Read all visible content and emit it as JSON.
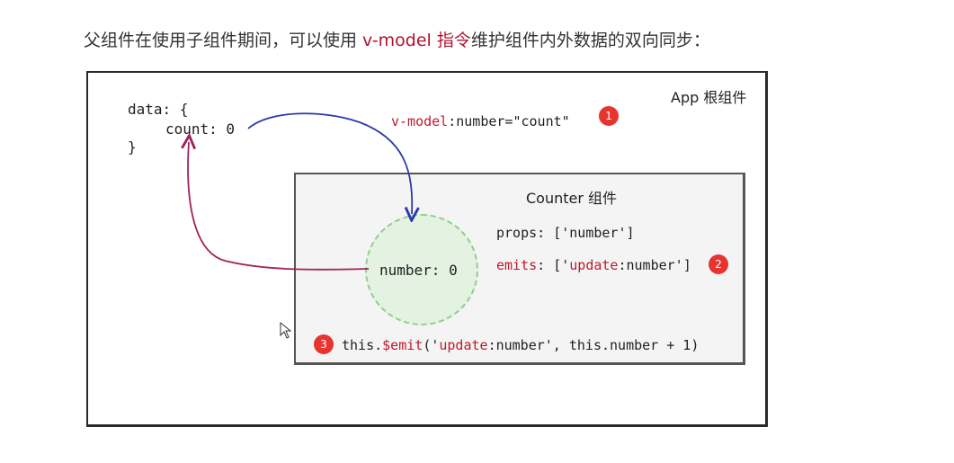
{
  "heading": {
    "prefix": "父组件在使用子组件期间，可以使用 ",
    "highlight": "v-model 指令",
    "suffix": "维护组件内外数据的双向同步："
  },
  "app": {
    "label": "App 根组件",
    "code": {
      "line1": "data: {",
      "line2": "count: 0",
      "line3": "}"
    }
  },
  "binding": {
    "keyword": "v-model",
    "rest": ":number=\"count\""
  },
  "counter": {
    "label": "Counter 组件",
    "props": "props: ['number']",
    "emits_key": "emits",
    "emits_mid": ": ['",
    "emits_event": "update",
    "emits_tail": ":number']",
    "state": "number: 0",
    "call": {
      "prefix": "this.",
      "method": "$emit",
      "open": "('",
      "event": "update",
      "rest": ":number', this.number + 1)"
    }
  },
  "badges": [
    "1",
    "2",
    "3"
  ],
  "colors": {
    "accent_red": "#c0192f",
    "arrow_blue": "#2c3aa8",
    "arrow_magenta": "#a0225a",
    "badge_red": "#e8342e"
  }
}
